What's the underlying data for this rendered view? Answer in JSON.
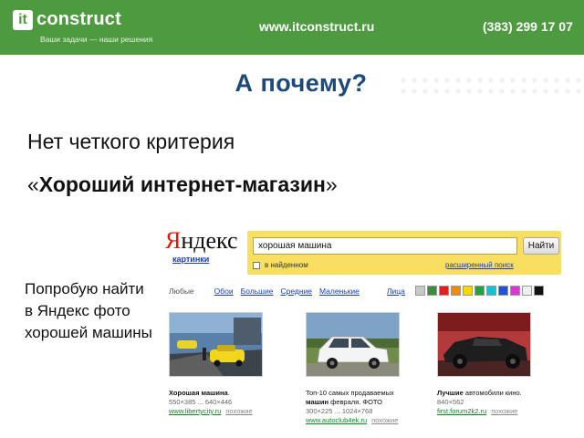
{
  "header": {
    "logo_it": "it",
    "logo_name": "construct",
    "tagline": "Ваши задачи — наши решения",
    "site": "www.itconstruct.ru",
    "phone": "(383) 299 17 07"
  },
  "slide": {
    "title": "А почему?",
    "line1": "Нет четкого критерия",
    "line2_open": "«",
    "line2_bold": "Хороший интернет-магазин",
    "line2_close": "»",
    "side_text": "Попробую найти в Яндекс фото хорошей машины"
  },
  "yandex": {
    "logo_first": "Я",
    "logo_rest": "ндекс",
    "section": "картинки",
    "query": "хорошая машина",
    "search_button": "Найти",
    "in_found": "в найденном",
    "advanced": "расширенный поиск",
    "filters": {
      "any": "Любые",
      "wallpapers": "Обои",
      "large": "Большие",
      "medium": "Средние",
      "small": "Маленькие",
      "faces": "Лица"
    },
    "color_swatches": [
      "#c8c8c8",
      "#3a8f3a",
      "#e02020",
      "#f08a00",
      "#f5d800",
      "#1fa33b",
      "#17c1d1",
      "#1e54d8",
      "#d63ad3",
      "#f0f0f0",
      "#111111"
    ],
    "results": [
      {
        "title_bold": "Хорошая машина",
        "title_rest": ".",
        "size": "550×385 ... 640×446",
        "link": "www.libertycity.ru",
        "similar": "похожие"
      },
      {
        "title_bold": "",
        "title_rest": "Топ-10 самых продаваемых",
        "title_line2_bold": "машин",
        "title_line2_rest": " февраля. ФОТО",
        "size": "300×225 ... 1024×768",
        "link": "www.autoclub4ek.ru",
        "similar": "похожие"
      },
      {
        "title_bold": "Лучшие",
        "title_rest": " автомобили кино.",
        "size": "840×562",
        "link": "first.forum2k2.ru",
        "similar": "похожие"
      }
    ]
  }
}
